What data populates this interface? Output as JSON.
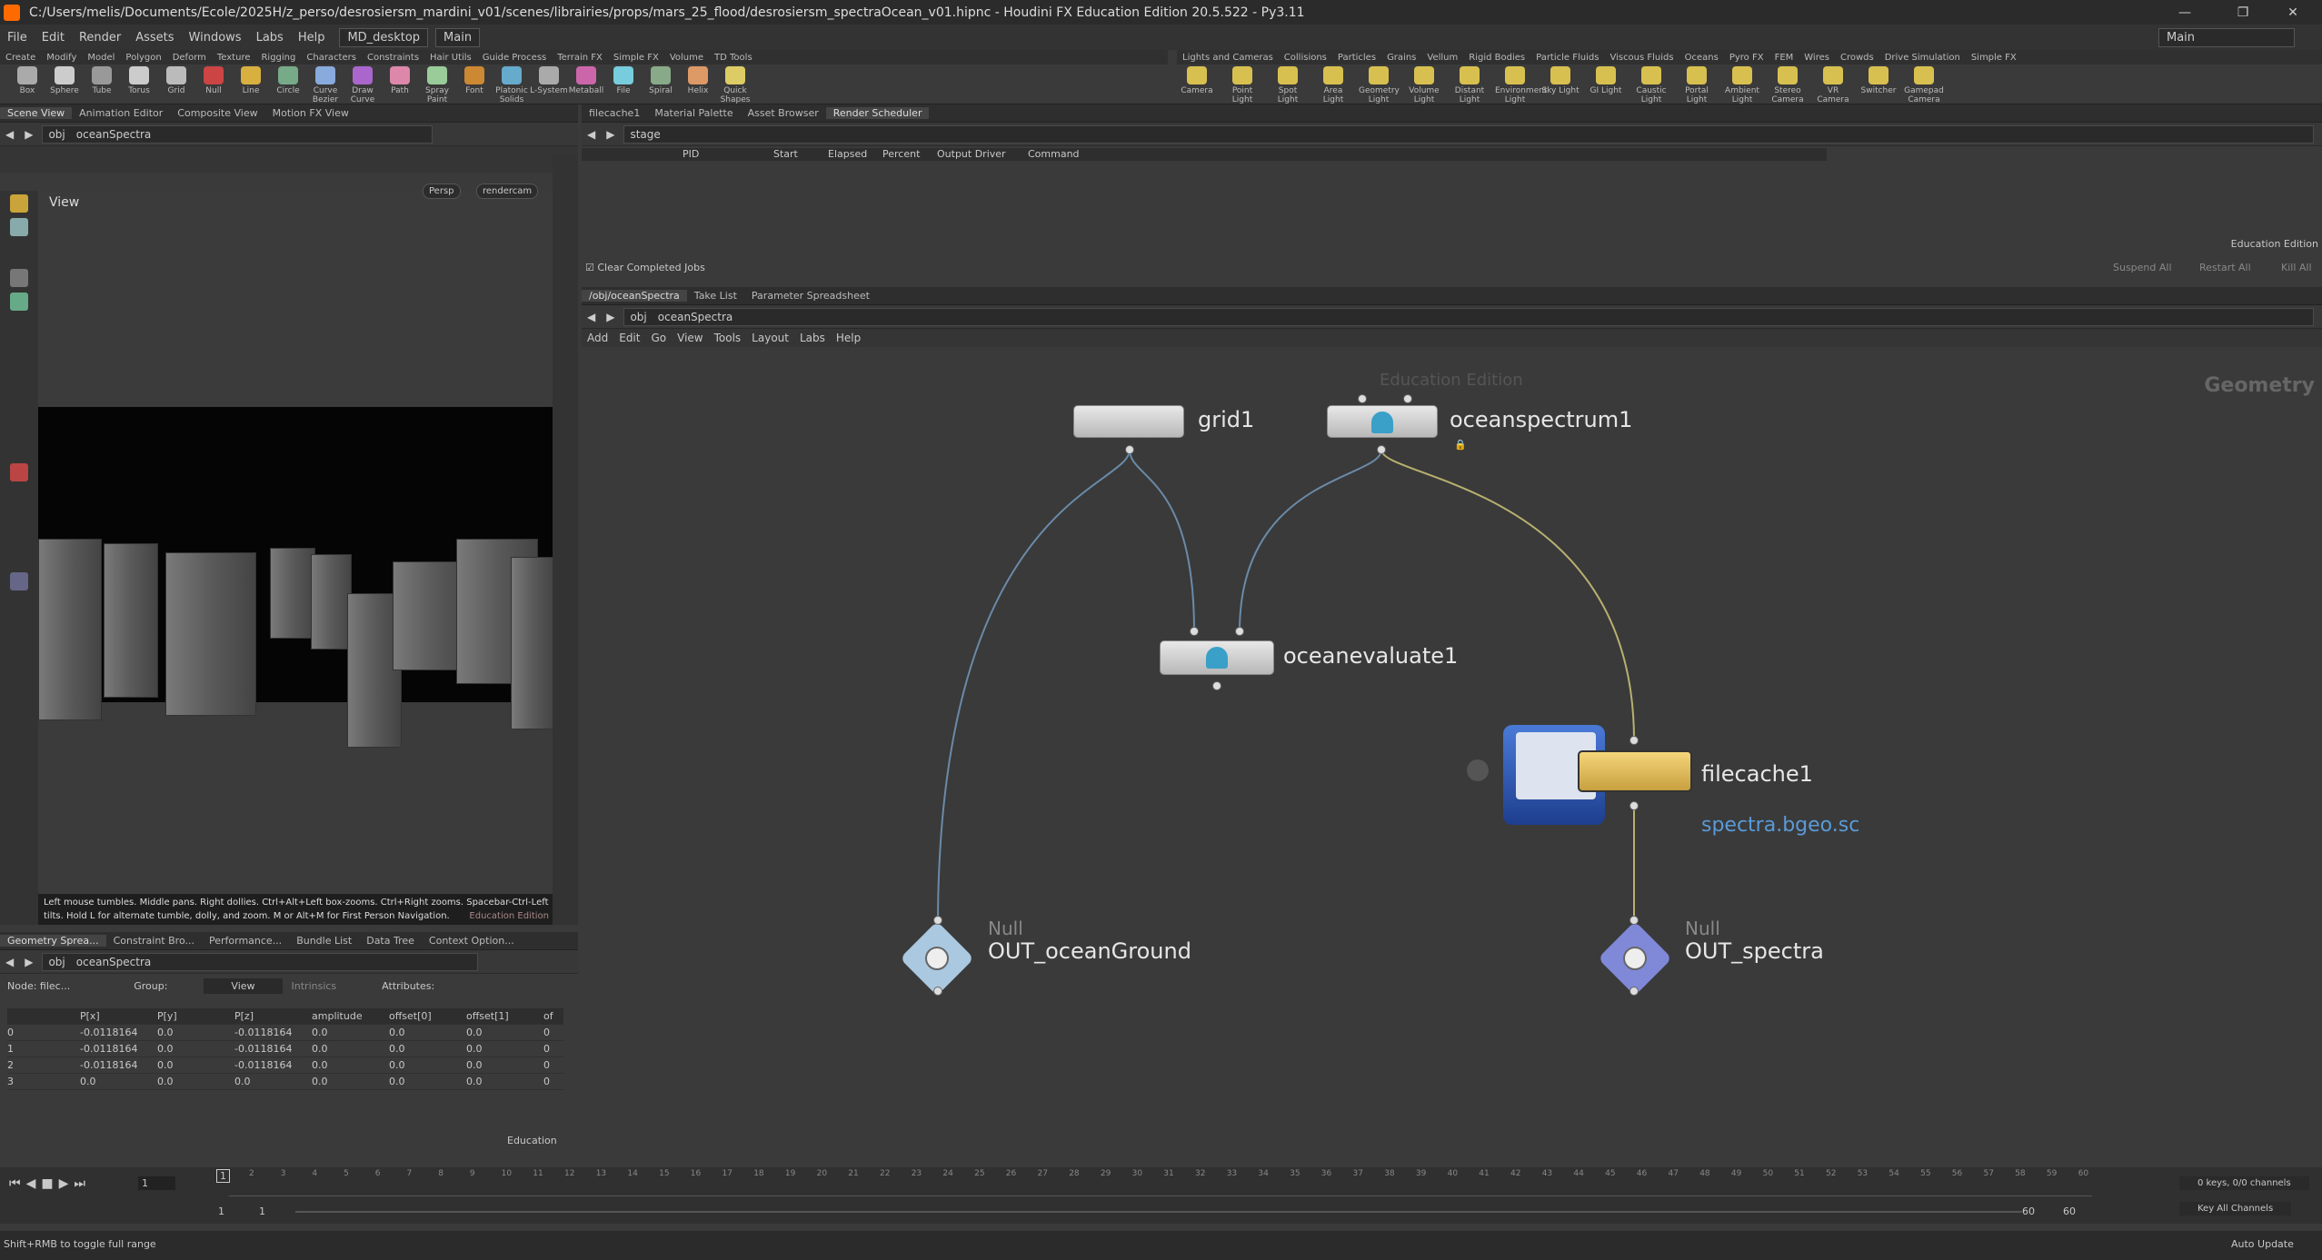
{
  "window": {
    "title": "C:/Users/melis/Documents/Ecole/2025H/z_perso/desrosiersm_mardini_v01/scenes/librairies/props/mars_25_flood/desrosiersm_spectraOcean_v01.hipnc - Houdini FX Education Edition 20.5.522 - Py3.11",
    "desktop_right": "Main"
  },
  "menu": [
    "File",
    "Edit",
    "Render",
    "Assets",
    "Windows",
    "Labs",
    "Help"
  ],
  "desktop": "MD_desktop",
  "desktop2": "Main",
  "shelf_left_tabs": [
    "Create",
    "Modify",
    "Model",
    "Polygon",
    "Deform",
    "Texture",
    "Rigging",
    "Characters",
    "Constraints",
    "Hair Utils",
    "Guide Process",
    "Terrain FX",
    "Simple FX",
    "Volume",
    "TD Tools"
  ],
  "shelf_left_tools": [
    "Box",
    "Sphere",
    "Tube",
    "Torus",
    "Grid",
    "Null",
    "Line",
    "Circle",
    "Curve Bezier",
    "Draw Curve",
    "Path",
    "Spray Paint",
    "Font",
    "Platonic Solids",
    "L-System",
    "Metaball",
    "File",
    "Spiral",
    "Helix",
    "Quick Shapes"
  ],
  "shelf_right_tabs": [
    "Lights and Cameras",
    "Collisions",
    "Particles",
    "Grains",
    "Vellum",
    "Rigid Bodies",
    "Particle Fluids",
    "Viscous Fluids",
    "Oceans",
    "Pyro FX",
    "FEM",
    "Wires",
    "Crowds",
    "Drive Simulation",
    "Simple FX"
  ],
  "shelf_right_tools": [
    "Camera",
    "Point Light",
    "Spot Light",
    "Area Light",
    "Geometry Light",
    "Volume Light",
    "Distant Light",
    "Environment Light",
    "Sky Light",
    "GI Light",
    "Caustic Light",
    "Portal Light",
    "Ambient Light",
    "Stereo Camera",
    "VR Camera",
    "Switcher",
    "Gamepad Camera"
  ],
  "left_tabs": [
    "Scene View",
    "Animation Editor",
    "Composite View",
    "Motion FX View"
  ],
  "left_path": {
    "root": "obj",
    "node": "oceanSpectra"
  },
  "viewport": {
    "label": "View",
    "persp": "Persp",
    "cam": "rendercam",
    "help": "Left mouse tumbles. Middle pans. Right dollies. Ctrl+Alt+Left box-zooms. Ctrl+Right zooms. Spacebar-Ctrl-Left tilts. Hold L for alternate tumble, dolly, and zoom. M or Alt+M for First Person Navigation.",
    "edu": "Education Edition"
  },
  "top_tabs": [
    "filecache1",
    "Material Palette",
    "Asset Browser",
    "Render Scheduler"
  ],
  "scheduler": {
    "path": "stage",
    "cols": [
      "PID",
      "Start",
      "Elapsed",
      "Percent",
      "Output Driver",
      "Command"
    ],
    "clear": "Clear Completed Jobs",
    "edu": "Education Edition",
    "buttons": [
      "Suspend All",
      "Restart All",
      "Kill All"
    ]
  },
  "net_tabs": [
    "/obj/oceanSpectra",
    "Take List",
    "Parameter Spreadsheet"
  ],
  "net_path": {
    "root": "obj",
    "node": "oceanSpectra"
  },
  "net_menu": [
    "Add",
    "Edit",
    "Go",
    "View",
    "Tools",
    "Layout",
    "Labs",
    "Help"
  ],
  "net": {
    "context": "Geometry",
    "watermark": "Education Edition",
    "nodes": {
      "grid": "grid1",
      "spectrum": "oceanspectrum1",
      "evaluate": "oceanevaluate1",
      "cache": "filecache1",
      "cache_file": "spectra.bgeo.sc",
      "null1_type": "Null",
      "null1": "OUT_oceanGround",
      "null2_type": "Null",
      "null2": "OUT_spectra"
    }
  },
  "bottom_tabs": [
    "Geometry Sprea...",
    "Constraint Bro...",
    "Performance...",
    "Bundle List",
    "Data Tree",
    "Context Option..."
  ],
  "bottom_path": {
    "root": "obj",
    "node": "oceanSpectra"
  },
  "spreadsheet": {
    "node": "Node: filec...",
    "group": "Group:",
    "view": "View",
    "intrinsic": "Intrinsics",
    "attrs": "Attributes:",
    "cols": [
      "",
      "P[x]",
      "P[y]",
      "P[z]",
      "amplitude",
      "offset[0]",
      "offset[1]",
      "of"
    ],
    "rows": [
      [
        "0",
        "-0.0118164",
        "0.0",
        "-0.0118164",
        "0.0",
        "0.0",
        "0.0",
        "0"
      ],
      [
        "1",
        "-0.0118164",
        "0.0",
        "-0.0118164",
        "0.0",
        "0.0",
        "0.0",
        "0"
      ],
      [
        "2",
        "-0.0118164",
        "0.0",
        "-0.0118164",
        "0.0",
        "0.0",
        "0.0",
        "0"
      ],
      [
        "3",
        "0.0",
        "0.0",
        "0.0",
        "0.0",
        "0.0",
        "0.0",
        "0"
      ]
    ],
    "edu": "Education"
  },
  "timeline": {
    "frame": "1",
    "ticks": [
      "2",
      "3",
      "4",
      "5",
      "6",
      "7",
      "8",
      "9",
      "10",
      "11",
      "12",
      "13",
      "14",
      "15",
      "16",
      "17",
      "18",
      "19",
      "20",
      "21",
      "22",
      "23",
      "24",
      "25",
      "26",
      "27",
      "28",
      "29",
      "30",
      "31",
      "32",
      "33",
      "34",
      "35",
      "36",
      "37",
      "38",
      "39",
      "40",
      "41",
      "42",
      "43",
      "44",
      "45",
      "46",
      "47",
      "48",
      "49",
      "50",
      "51",
      "52",
      "53",
      "54",
      "55",
      "56",
      "57",
      "58",
      "59",
      "60"
    ],
    "start": "1",
    "start2": "1",
    "end": "60",
    "end2": "60",
    "keys": "0 keys, 0/0 channels",
    "keyall": "Key All Channels",
    "auto": "Auto Update"
  },
  "status": "Shift+RMB to toggle full range",
  "frame_marker": "1"
}
